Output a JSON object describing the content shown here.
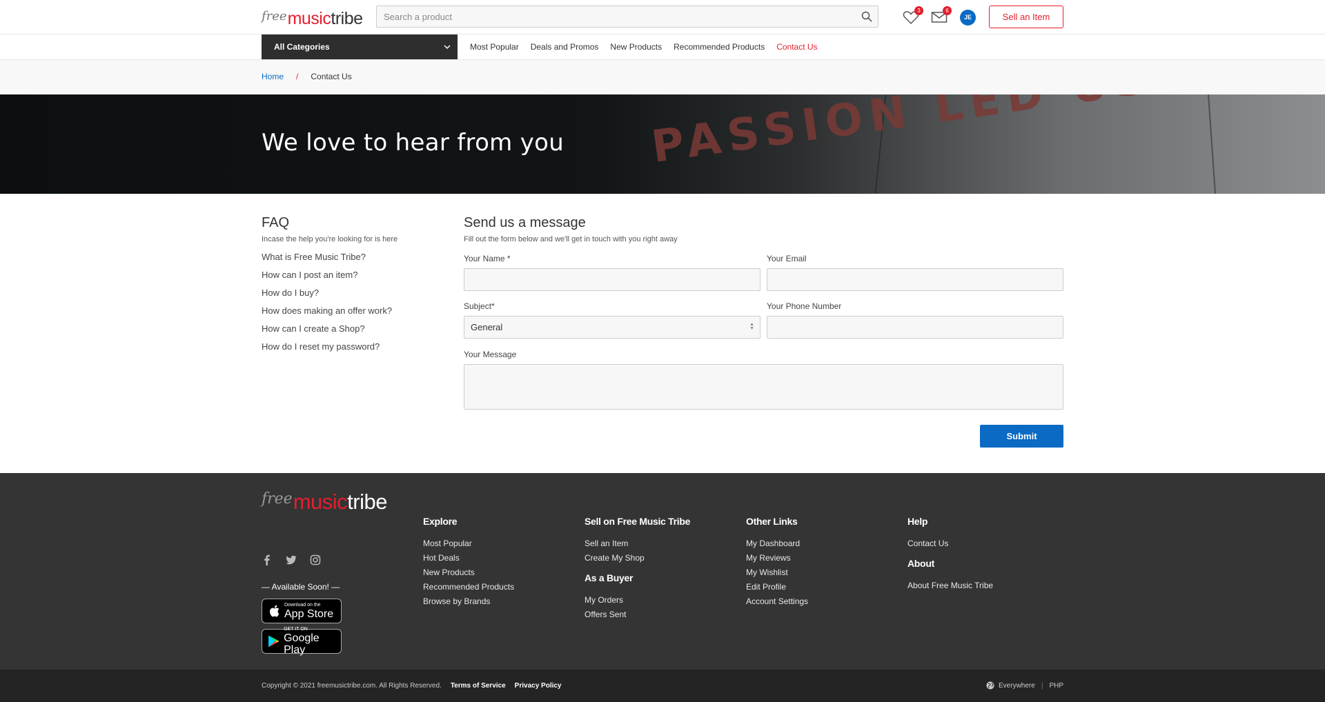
{
  "header": {
    "logo_free": "free",
    "logo_music": "music",
    "logo_tribe": "tribe",
    "search_placeholder": "Search a product",
    "wishlist_count": "3",
    "messages_count": "6",
    "avatar_initials": "JE",
    "sell_label": "Sell an Item"
  },
  "nav": {
    "category_label": "All Categories",
    "links": [
      "Most Popular",
      "Deals and Promos",
      "New Products",
      "Recommended Products",
      "Contact Us"
    ]
  },
  "breadcrumb": {
    "home": "Home",
    "separator": "/",
    "current": "Contact Us"
  },
  "hero": {
    "title": "We love to hear from you",
    "background_text": "PASSION LED US HERE"
  },
  "faq": {
    "title": "FAQ",
    "subtitle": "Incase the help you're looking for is here",
    "items": [
      "What is Free Music Tribe?",
      "How can I post an item?",
      "How do I buy?",
      "How does making an offer work?",
      "How can I create a Shop?",
      "How do I reset my password?"
    ]
  },
  "form": {
    "title": "Send us a message",
    "subtitle": "Fill out the form below and we'll get in touch with you right away",
    "name_label": "Your Name *",
    "email_label": "Your Email",
    "subject_label": "Subject*",
    "subject_value": "General",
    "phone_label": "Your Phone Number",
    "message_label": "Your Message",
    "submit_label": "Submit"
  },
  "footer": {
    "available": "— Available Soon! —",
    "appstore_small": "Download on the",
    "appstore_big": "App Store",
    "gplay_small": "GET IT ON",
    "gplay_big": "Google Play",
    "explore": {
      "title": "Explore",
      "links": [
        "Most Popular",
        "Hot Deals",
        "New Products",
        "Recommended Products",
        "Browse by Brands"
      ]
    },
    "sell": {
      "title": "Sell on Free Music Tribe",
      "links": [
        "Sell an Item",
        "Create My Shop"
      ]
    },
    "buyer": {
      "title": "As a Buyer",
      "links": [
        "My Orders",
        "Offers Sent"
      ]
    },
    "other": {
      "title": "Other Links",
      "links": [
        "My Dashboard",
        "My Reviews",
        "My Wishlist",
        "Edit Profile",
        "Account Settings"
      ]
    },
    "help": {
      "title": "Help",
      "links": [
        "Contact Us"
      ]
    },
    "about": {
      "title": "About",
      "links": [
        "About Free Music Tribe"
      ]
    },
    "copyright": "Copyright © 2021 freemusictribe.com. All Rights Reserved.",
    "terms": "Terms of Service",
    "privacy": "Privacy Policy",
    "region": "Everywhere",
    "currency": "PHP"
  },
  "colors": {
    "brand_red": "#e31e2d",
    "primary_blue": "#0a6ac4",
    "footer_bg": "#343434"
  }
}
